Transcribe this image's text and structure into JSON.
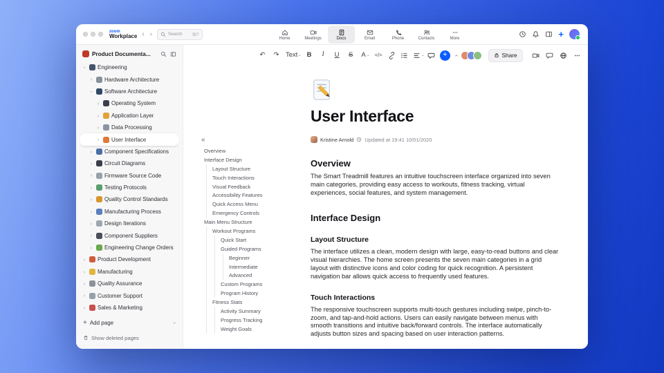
{
  "titlebar": {
    "logo_top": "zoom",
    "logo_bottom": "Workplace",
    "search_placeholder": "Search",
    "search_shortcut": "⌘F",
    "tabs": [
      {
        "label": "Home"
      },
      {
        "label": "Meetings"
      },
      {
        "label": "Docs",
        "active": true
      },
      {
        "label": "Email"
      },
      {
        "label": "Phone"
      },
      {
        "label": "Contacts"
      },
      {
        "label": "More"
      }
    ]
  },
  "sidebar": {
    "workspace_title": "Product Documenta...",
    "items": [
      {
        "label": "Engineering",
        "indent": 0,
        "type": "chev-d",
        "color": "#44546a"
      },
      {
        "label": "Hardware Architecture",
        "indent": 1,
        "type": "chev-r",
        "color": "#8a9099"
      },
      {
        "label": "Software Architecture",
        "indent": 1,
        "type": "chev-d",
        "color": "#2f4a66"
      },
      {
        "label": "Operating System",
        "indent": 2,
        "type": "chev-r",
        "color": "#39404c"
      },
      {
        "label": "Application Layer",
        "indent": 2,
        "type": "chev-r",
        "color": "#e2a23b"
      },
      {
        "label": "Data Processing",
        "indent": 2,
        "type": "chev-r",
        "color": "#8b94a3"
      },
      {
        "label": "User Interface",
        "indent": 2,
        "type": "chev-r",
        "color": "#e0793c",
        "selected": true
      },
      {
        "label": "Component Specifications",
        "indent": 1,
        "type": "chev-r",
        "color": "#4a6fa5"
      },
      {
        "label": "Circuit Diagrams",
        "indent": 1,
        "type": "chev-r",
        "color": "#3a3f4a"
      },
      {
        "label": "Firmware Source Code",
        "indent": 1,
        "type": "chev-r",
        "color": "#9aa0a8"
      },
      {
        "label": "Testing Protocols",
        "indent": 1,
        "type": "chev-r",
        "color": "#5a9e6f"
      },
      {
        "label": "Quality Control Standards",
        "indent": 1,
        "type": "chev-r",
        "color": "#d9952e"
      },
      {
        "label": "Manufacturing Process",
        "indent": 1,
        "type": "chev-r",
        "color": "#5b7fbf"
      },
      {
        "label": "Design Iterations",
        "indent": 1,
        "type": "chev-r",
        "color": "#a0a6ad"
      },
      {
        "label": "Component Suppliers",
        "indent": 1,
        "type": "chev-r",
        "color": "#4a4f59"
      },
      {
        "label": "Engineering Change Orders",
        "indent": 1,
        "type": "chev-r",
        "color": "#6aa84f"
      },
      {
        "label": "Product Development",
        "indent": 0,
        "type": "chev-r",
        "color": "#d05c3e"
      },
      {
        "label": "Manufacturing",
        "indent": 0,
        "type": "chev-r",
        "color": "#e0b53d"
      },
      {
        "label": "Quality Assurance",
        "indent": 0,
        "type": "chev-r",
        "color": "#8d939b"
      },
      {
        "label": "Customer Support",
        "indent": 0,
        "type": "chev-r",
        "color": "#97a1ab"
      },
      {
        "label": "Sales & Marketing",
        "indent": 0,
        "type": "chev-r",
        "color": "#c9504f"
      }
    ],
    "add_page": "Add page",
    "show_deleted": "Show deleted pages"
  },
  "outline": {
    "collapse_icon": "«",
    "items": [
      {
        "label": "Overview",
        "indent": 0
      },
      {
        "label": "Interface Design",
        "indent": 0
      },
      {
        "label": "Layout Structure",
        "indent": 1
      },
      {
        "label": "Touch Interactions",
        "indent": 1
      },
      {
        "label": "Visual Feedback",
        "indent": 1
      },
      {
        "label": "Accessibility Features",
        "indent": 1
      },
      {
        "label": "Quick Access Menu",
        "indent": 1
      },
      {
        "label": "Emergency Controls",
        "indent": 1
      },
      {
        "label": "Main Menu Structure",
        "indent": 0
      },
      {
        "label": "Workout Programs",
        "indent": 1
      },
      {
        "label": "Quick Start",
        "indent": 2
      },
      {
        "label": "Guided Programs",
        "indent": 2
      },
      {
        "label": "Beginner",
        "indent": 3
      },
      {
        "label": "Intermediate",
        "indent": 3
      },
      {
        "label": "Advanced",
        "indent": 3
      },
      {
        "label": "Custom Programs",
        "indent": 2
      },
      {
        "label": "Program History",
        "indent": 2
      },
      {
        "label": "Fitness Stats",
        "indent": 1
      },
      {
        "label": "Activity Summary",
        "indent": 2
      },
      {
        "label": "Progress Tracking",
        "indent": 2
      },
      {
        "label": "Weight Goals",
        "indent": 2
      }
    ]
  },
  "toolbar": {
    "undo": "↶",
    "redo": "↷",
    "text_label": "Text",
    "bold": "B",
    "italic": "I",
    "underline": "U",
    "strike": "S",
    "color": "A",
    "code": "</>",
    "share_label": "Share",
    "avatars": [
      "#e08b6d",
      "#6d8be0",
      "#8fbf7f"
    ]
  },
  "doc": {
    "title": "User Interface",
    "author": "Kristine Arnold",
    "updated": "Updated at 19:41 10/01/2020",
    "sections": [
      {
        "type": "h2",
        "text": "Overview"
      },
      {
        "type": "p",
        "text": "The Smart Treadmill features an intuitive touchscreen interface organized into seven main categories, providing easy access to workouts, fitness tracking, virtual experiences, social features, and system management."
      },
      {
        "type": "h2",
        "text": "Interface Design"
      },
      {
        "type": "h3",
        "text": "Layout Structure"
      },
      {
        "type": "p",
        "text": "The interface utilizes a clean, modern design with large, easy-to-read buttons and clear visual hierarchies. The home screen presents the seven main categories in a grid layout with distinctive icons and color coding for quick recognition. A persistent navigation bar allows quick access to frequently used features."
      },
      {
        "type": "h3",
        "text": "Touch Interactions"
      },
      {
        "type": "p",
        "text": "The responsive touchscreen supports multi-touch gestures including swipe, pinch-to-zoom, and tap-and-hold actions. Users can easily navigate between menus with smooth transitions and intuitive back/forward controls. The interface automatically adjusts button sizes and spacing based on user interaction patterns."
      }
    ]
  },
  "colors": {
    "accent": "#0b5cff"
  }
}
